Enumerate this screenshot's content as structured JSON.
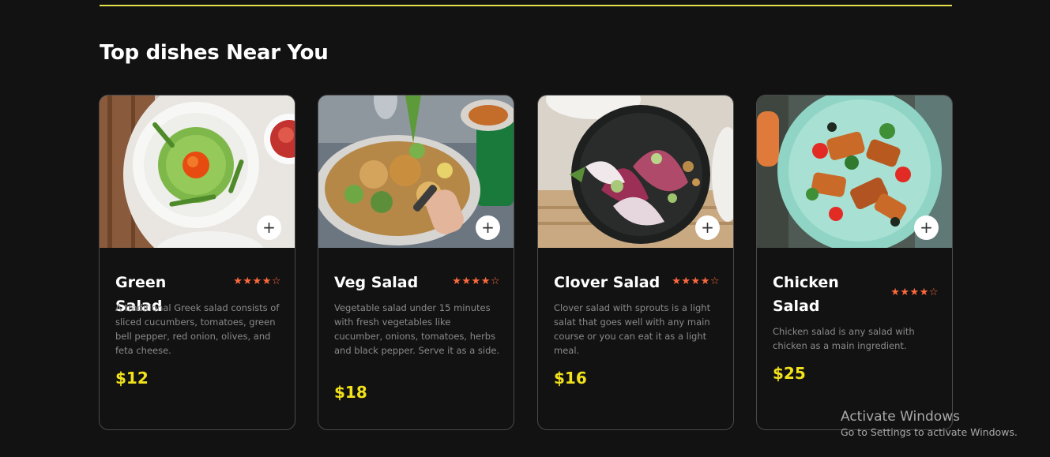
{
  "section": {
    "title": "Top dishes Near You"
  },
  "colors": {
    "accent_rule": "#e6e04a",
    "star": "#ff6a3d",
    "price": "#f2e21b"
  },
  "cards": [
    {
      "name": "Green Salad",
      "rating": 4,
      "max_rating": 5,
      "description": "A traditional Greek salad consists of sliced cucumbers, tomatoes, green bell pepper, red onion, olives, and feta cheese.",
      "price": "$12",
      "add_label": "+",
      "image_icon": "green-salad-photo"
    },
    {
      "name": "Veg Salad",
      "rating": 4,
      "max_rating": 5,
      "description": "Vegetable salad under 15 minutes with fresh vegetables like cucumber, onions, tomatoes, herbs and black pepper. Serve it as a side.",
      "price": "$18",
      "add_label": "+",
      "image_icon": "veg-salad-photo"
    },
    {
      "name": "Clover Salad",
      "rating": 4,
      "max_rating": 5,
      "description": "Clover salad with sprouts is a light salat that goes well with any main course or you can eat it as a light meal.",
      "price": "$16",
      "add_label": "+",
      "image_icon": "clover-salad-photo"
    },
    {
      "name": "Chicken Salad",
      "rating": 4,
      "max_rating": 5,
      "description": "Chicken salad is any salad with chicken as a main ingredient.",
      "price": "$25",
      "add_label": "+",
      "image_icon": "chicken-salad-photo"
    }
  ],
  "watermark": {
    "title": "Activate Windows",
    "subtitle": "Go to Settings to activate Windows."
  }
}
